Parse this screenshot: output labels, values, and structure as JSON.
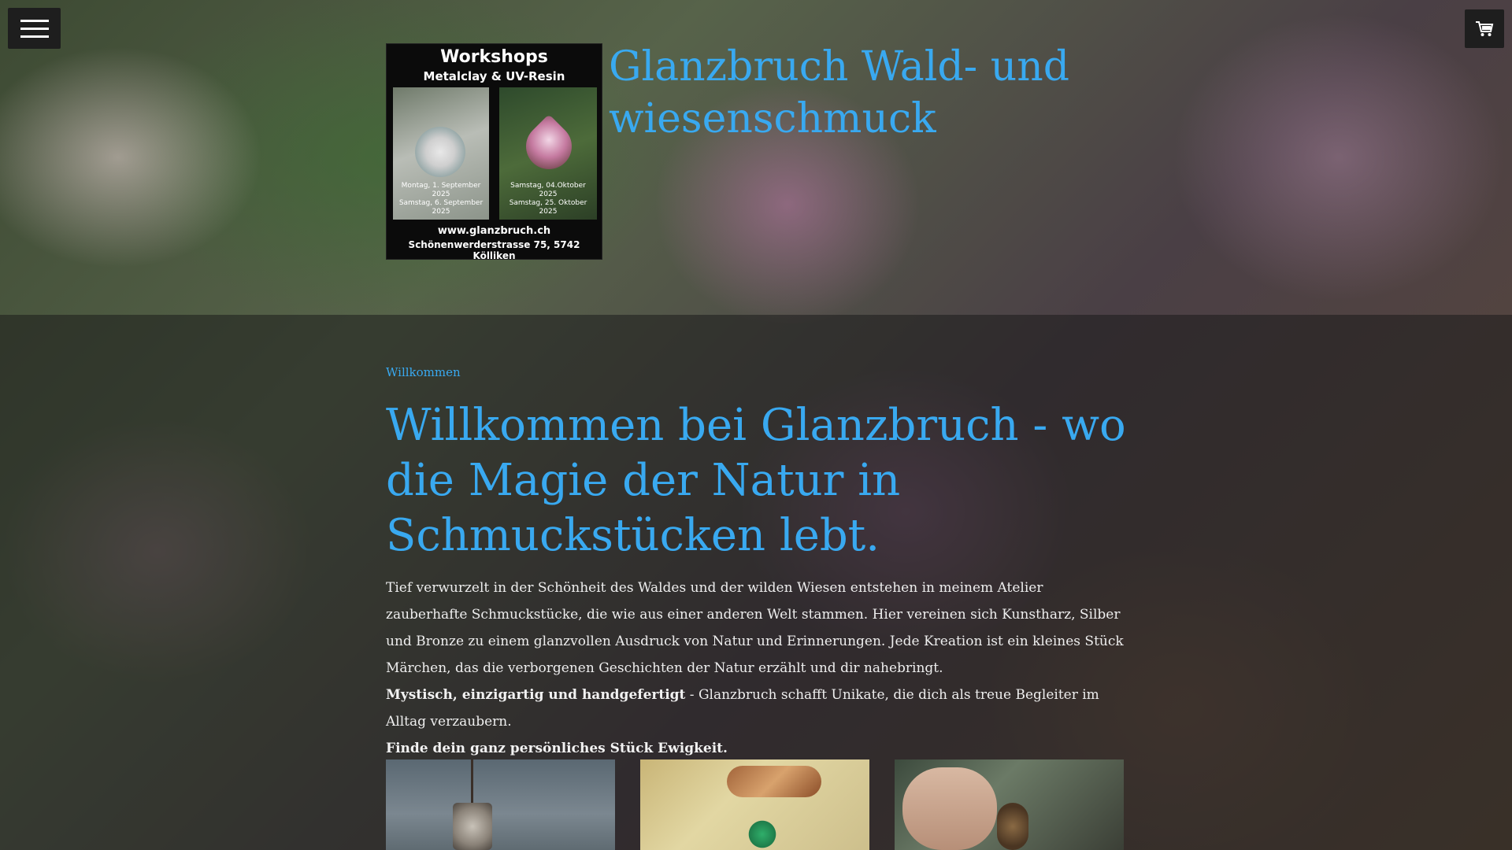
{
  "header": {
    "site_title": "Glanzbruch Wald- und wiesenschmuck",
    "logo": {
      "title": "Workshops",
      "subtitle": "Metalclay & UV-Resin",
      "left_dates": "Montag, 1. September 2025\nSamstag, 6. September 2025",
      "right_dates": "Samstag, 04.Oktober 2025\nSamstag, 25. Oktober 2025",
      "url": "www.glanzbruch.ch",
      "address": "Schönenwerderstrasse 75, 5742 Kölliken"
    },
    "menu_icon": "hamburger-menu-icon",
    "cart_icon": "shopping-cart-icon"
  },
  "main": {
    "eyebrow": "Willkommen",
    "heading": "Willkommen bei Glanzbruch - wo die Magie der Natur in Schmuckstücken lebt.",
    "paragraph": "Tief verwurzelt in der Schönheit des Waldes und der wilden Wiesen entstehen in meinem Atelier zauberhafte Schmuckstücke, die wie aus einer anderen Welt stammen. Hier vereinen sich Kunstharz, Silber und Bronze zu einem glanzvollen Ausdruck von Natur und Erinnerungen. Jede Kreation ist ein kleines Stück Märchen, das die verborgenen Geschichten der Natur erzählt und dir nahebringt.",
    "tagline_bold": "Mystisch, einzigartig und handgefertigt",
    "tagline_rest": " - Glanzbruch schafft Unikate, die dich als treue Begleiter im Alltag verzaubern.",
    "closing": "Finde dein ganz persönliches Stück Ewigkeit."
  },
  "colors": {
    "accent": "#39a9f0",
    "button_bg": "#1e1e1e"
  }
}
